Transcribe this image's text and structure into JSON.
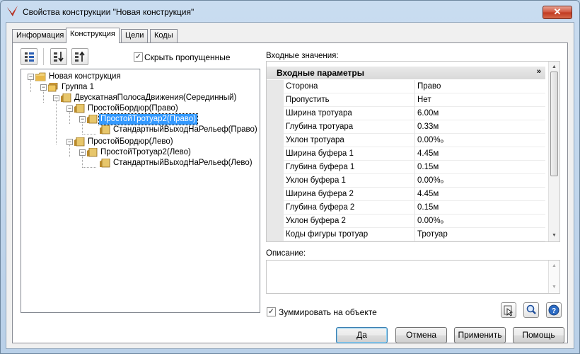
{
  "window": {
    "title": "Свойства конструкции \"Новая конструкция\"",
    "close_label": "✕"
  },
  "tabs": [
    {
      "label": "Информация",
      "active": false
    },
    {
      "label": "Конструкция",
      "active": true
    },
    {
      "label": "Цели",
      "active": false
    },
    {
      "label": "Коды",
      "active": false
    }
  ],
  "toolbar": {
    "icons": [
      "tree-view-icon",
      "move-down-icon",
      "move-up-icon"
    ]
  },
  "hide_skipped": {
    "label": "Скрыть пропущенные",
    "checked": true
  },
  "tree": {
    "nodes": [
      {
        "label": "Новая конструкция",
        "level": 0,
        "expander": "-",
        "icon": "folder-icon"
      },
      {
        "label": "Группа 1",
        "level": 1,
        "expander": "-",
        "icon": "folder-stack-icon"
      },
      {
        "label": "ДвускатнаяПолосаДвижения(Серединный)",
        "level": 2,
        "expander": "-",
        "icon": "subassembly-icon"
      },
      {
        "label": "ПростойБордюр(Право)",
        "level": 3,
        "expander": "-",
        "icon": "subassembly-icon"
      },
      {
        "label": "ПростойТротуар2(Право)",
        "level": 4,
        "expander": "-",
        "icon": "subassembly-icon",
        "selected": true
      },
      {
        "label": "СтандартныйВыходНаРельеф(Право)",
        "level": 5,
        "expander": "",
        "icon": "subassembly-icon"
      },
      {
        "label": "ПростойБордюр(Лево)",
        "level": 3,
        "expander": "-",
        "icon": "subassembly-icon"
      },
      {
        "label": "ПростойТротуар2(Лево)",
        "level": 4,
        "expander": "-",
        "icon": "subassembly-icon"
      },
      {
        "label": "СтандартныйВыходНаРельеф(Лево)",
        "level": 5,
        "expander": "",
        "icon": "subassembly-icon"
      }
    ]
  },
  "input_values": {
    "label": "Входные значения:",
    "section_title": "Входные параметры",
    "rows": [
      {
        "name": "Сторона",
        "value": "Право"
      },
      {
        "name": "Пропустить",
        "value": "Нет"
      },
      {
        "name": "Ширина тротуара",
        "value": "6.00м"
      },
      {
        "name": "Глубина тротуара",
        "value": "0.33м"
      },
      {
        "name": "Уклон тротуара",
        "value": "0.00%ₒ"
      },
      {
        "name": "Ширина буфера 1",
        "value": "4.45м"
      },
      {
        "name": "Глубина буфера 1",
        "value": "0.15м"
      },
      {
        "name": "Уклон буфера 1",
        "value": "0.00%ₒ"
      },
      {
        "name": "Ширина буфера 2",
        "value": "4.45м"
      },
      {
        "name": "Глубина буфера 2",
        "value": "0.15м"
      },
      {
        "name": "Уклон буфера 2",
        "value": "0.00%ₒ"
      },
      {
        "name": "Коды фигуры тротуар",
        "value": "Тротуар"
      }
    ]
  },
  "description": {
    "label": "Описание:",
    "value": ""
  },
  "zoom_to_object": {
    "label": "Зуммировать на объекте",
    "checked": true
  },
  "buttons": {
    "ok": "Да",
    "cancel": "Отмена",
    "apply": "Применить",
    "help": "Помощь"
  }
}
